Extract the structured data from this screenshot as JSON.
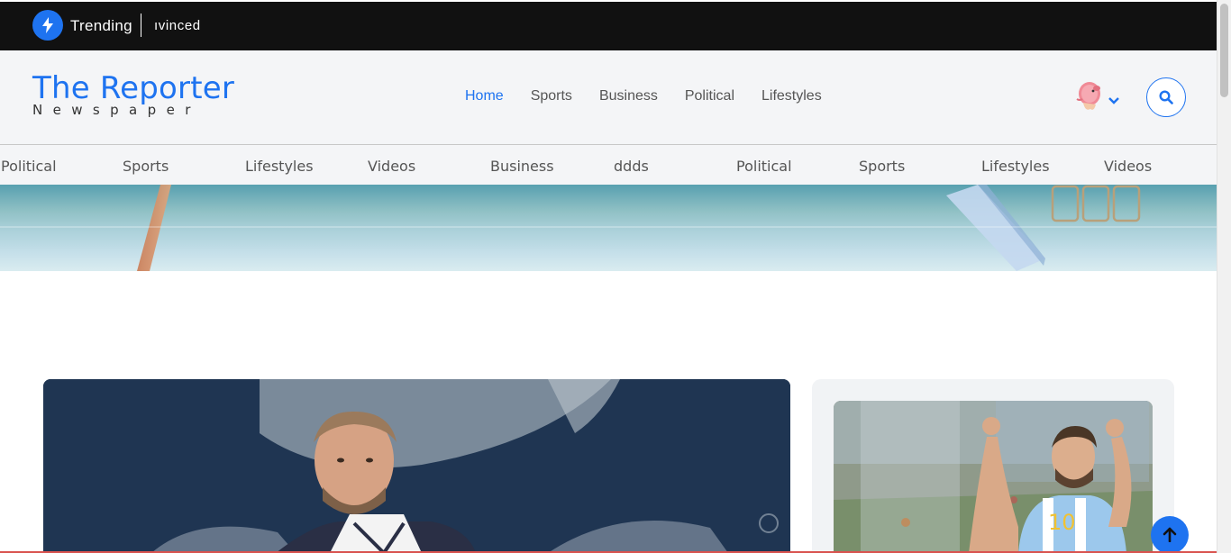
{
  "trending": {
    "label": "Trending",
    "ticker_text": "ıvinced"
  },
  "header": {
    "logo_title": "The Reporter",
    "logo_subtitle": "Newspaper",
    "nav": [
      "Home",
      "Sports",
      "Business",
      "Political",
      "Lifestyles"
    ],
    "active_nav": "Home"
  },
  "categories": [
    "Political",
    "Sports",
    "Lifestyles",
    "Videos",
    "Business",
    "ddds",
    "Political",
    "Sports",
    "Lifestyles",
    "Videos"
  ],
  "colors": {
    "accent": "#1e73f0",
    "topbar": "#111111",
    "header_bg": "#f4f5f7"
  },
  "icons": {
    "trending": "lightning-bolt-icon",
    "search": "search-icon",
    "caret": "chevron-down-icon",
    "back_to_top": "arrow-up-icon"
  }
}
